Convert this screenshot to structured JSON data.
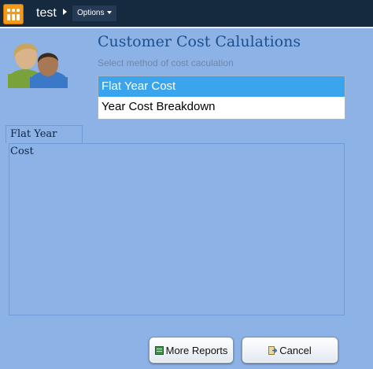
{
  "topbar": {
    "app_title": "test",
    "options_label": "Options"
  },
  "header": {
    "title": "Customer Cost Calulations",
    "subtitle": "Select method of cost caculation"
  },
  "methods": {
    "items": [
      "Flat Year Cost",
      "Year Cost Breakdown"
    ],
    "selected_index": 0
  },
  "tab": {
    "label": "Flat Year Cost"
  },
  "buttons": {
    "more_reports": "More Reports",
    "cancel": "Cancel"
  },
  "colors": {
    "background": "#8db2e6",
    "topbar": "#15293f",
    "accent": "#3aa4ed",
    "title": "#1d4f8c",
    "app_icon": "#f39a1e"
  },
  "icons": {
    "app": "app-logo-icon",
    "users": "users-icon",
    "reports": "report-icon",
    "cancel": "cancel-icon"
  }
}
